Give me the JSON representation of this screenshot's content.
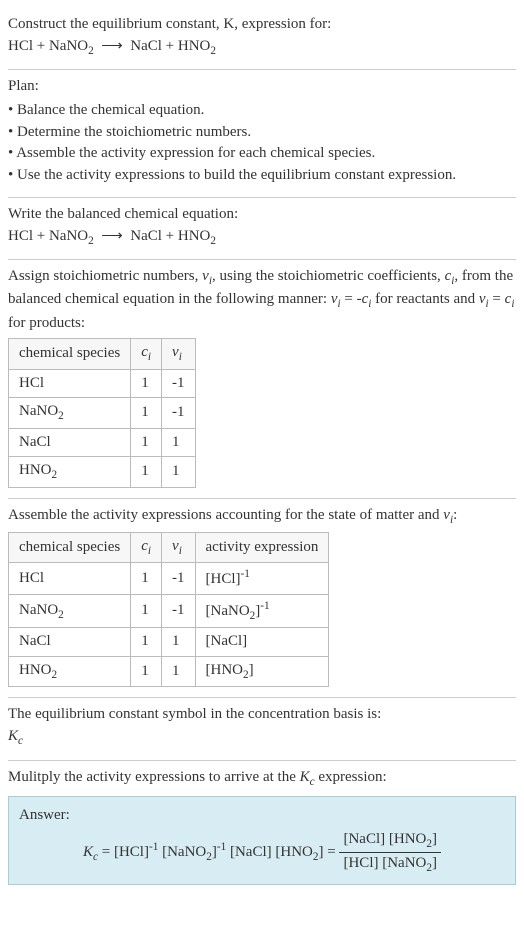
{
  "intro": {
    "line1": "Construct the equilibrium constant, K, expression for:",
    "equation_html": "HCl + NaNO<sub>2</sub> &nbsp;⟶&nbsp; NaCl + HNO<sub>2</sub>"
  },
  "plan": {
    "title": "Plan:",
    "items": [
      "Balance the chemical equation.",
      "Determine the stoichiometric numbers.",
      "Assemble the activity expression for each chemical species.",
      "Use the activity expressions to build the equilibrium constant expression."
    ]
  },
  "balanced": {
    "title": "Write the balanced chemical equation:",
    "equation_html": "HCl + NaNO<sub>2</sub> &nbsp;⟶&nbsp; NaCl + HNO<sub>2</sub>"
  },
  "stoich": {
    "intro_html": "Assign stoichiometric numbers, <i>ν<sub>i</sub></i>, using the stoichiometric coefficients, <i>c<sub>i</sub></i>, from the balanced chemical equation in the following manner: <i>ν<sub>i</sub></i> = -<i>c<sub>i</sub></i> for reactants and <i>ν<sub>i</sub></i> = <i>c<sub>i</sub></i> for products:",
    "headers": {
      "h1": "chemical species",
      "h2_html": "<i>c<sub>i</sub></i>",
      "h3_html": "<i>ν<sub>i</sub></i>"
    },
    "rows": [
      {
        "species_html": "HCl",
        "c": "1",
        "v": "-1"
      },
      {
        "species_html": "NaNO<sub>2</sub>",
        "c": "1",
        "v": "-1"
      },
      {
        "species_html": "NaCl",
        "c": "1",
        "v": "1"
      },
      {
        "species_html": "HNO<sub>2</sub>",
        "c": "1",
        "v": "1"
      }
    ]
  },
  "activity": {
    "intro_html": "Assemble the activity expressions accounting for the state of matter and <i>ν<sub>i</sub></i>:",
    "headers": {
      "h1": "chemical species",
      "h2_html": "<i>c<sub>i</sub></i>",
      "h3_html": "<i>ν<sub>i</sub></i>",
      "h4": "activity expression"
    },
    "rows": [
      {
        "species_html": "HCl",
        "c": "1",
        "v": "-1",
        "act_html": "[HCl]<sup>-1</sup>"
      },
      {
        "species_html": "NaNO<sub>2</sub>",
        "c": "1",
        "v": "-1",
        "act_html": "[NaNO<sub>2</sub>]<sup>-1</sup>"
      },
      {
        "species_html": "NaCl",
        "c": "1",
        "v": "1",
        "act_html": "[NaCl]"
      },
      {
        "species_html": "HNO<sub>2</sub>",
        "c": "1",
        "v": "1",
        "act_html": "[HNO<sub>2</sub>]"
      }
    ]
  },
  "symbol": {
    "line1": "The equilibrium constant symbol in the concentration basis is:",
    "line2_html": "<i>K<sub>c</sub></i>"
  },
  "final": {
    "intro_html": "Mulitply the activity expressions to arrive at the <i>K<sub>c</sub></i> expression:",
    "answer_label": "Answer:",
    "expr_left_html": "<i>K<sub>c</sub></i> = [HCl]<sup>-1</sup> [NaNO<sub>2</sub>]<sup>-1</sup> [NaCl] [HNO<sub>2</sub>] = ",
    "frac_num_html": "[NaCl] [HNO<sub>2</sub>]",
    "frac_den_html": "[HCl] [NaNO<sub>2</sub>]"
  }
}
